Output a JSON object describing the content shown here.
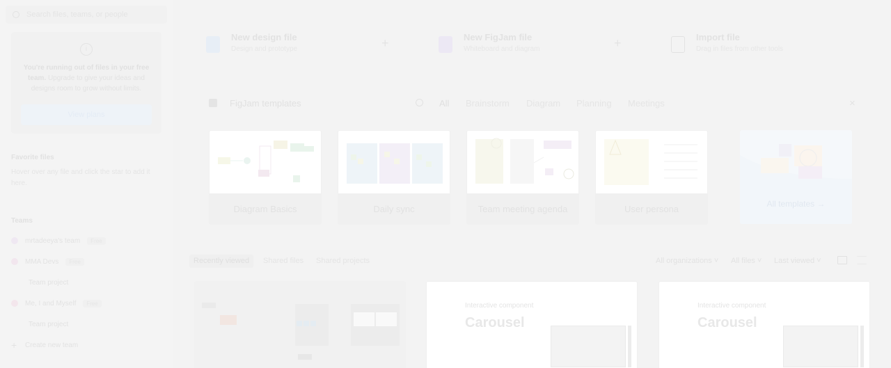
{
  "sidebar": {
    "search_placeholder": "Search files, teams, or people",
    "upgrade": {
      "info_glyph": "i",
      "bold": "You're running out of files in your free team.",
      "text": " Upgrade to give your ideas and designs room to grow without limits.",
      "button": "View plans"
    },
    "favorites_heading": "Favorite files",
    "favorites_note": "Hover over any file and click the star to add it here.",
    "teams_heading": "Teams",
    "teams": [
      {
        "name": "mrtadeeya's team",
        "badge": "Free",
        "color": "#efe8f2"
      },
      {
        "name": "MMA Devs",
        "badge": "Free",
        "color": "#f2e6ee"
      },
      {
        "name": "Team project"
      },
      {
        "name": "Me, I and Myself",
        "badge": "Free",
        "color": "#f3e6ec"
      },
      {
        "name": "Team project"
      }
    ],
    "create_team": "Create new team",
    "plus_glyph": "+"
  },
  "actions": [
    {
      "title": "New design file",
      "subtitle": "Design and prototype",
      "color": "#e7eef6"
    },
    {
      "title": "New FigJam file",
      "subtitle": "Whiteboard and diagram",
      "color": "#ece8f4"
    },
    {
      "title": "Import file",
      "subtitle": "Drag in files from other tools",
      "color": "#ececec"
    }
  ],
  "action_plus": "+",
  "templates": {
    "title": "FigJam templates",
    "tabs": [
      "All",
      "Brainstorm",
      "Diagram",
      "Planning",
      "Meetings"
    ],
    "close_glyph": "×",
    "cards": [
      "Diagram Basics",
      "Daily sync",
      "Team meeting agenda",
      "User persona"
    ],
    "all_label": "All templates →"
  },
  "recent": {
    "tabs": [
      "Recently viewed",
      "Shared files",
      "Shared projects"
    ],
    "filters": [
      "All organizations ˅",
      "All files ˅",
      "Last viewed ˅"
    ],
    "files": [
      {
        "kicker": "",
        "title": ""
      },
      {
        "kicker": "Interactive component",
        "title": "Carousel"
      },
      {
        "kicker": "Interactive component",
        "title": "Carousel"
      }
    ]
  }
}
